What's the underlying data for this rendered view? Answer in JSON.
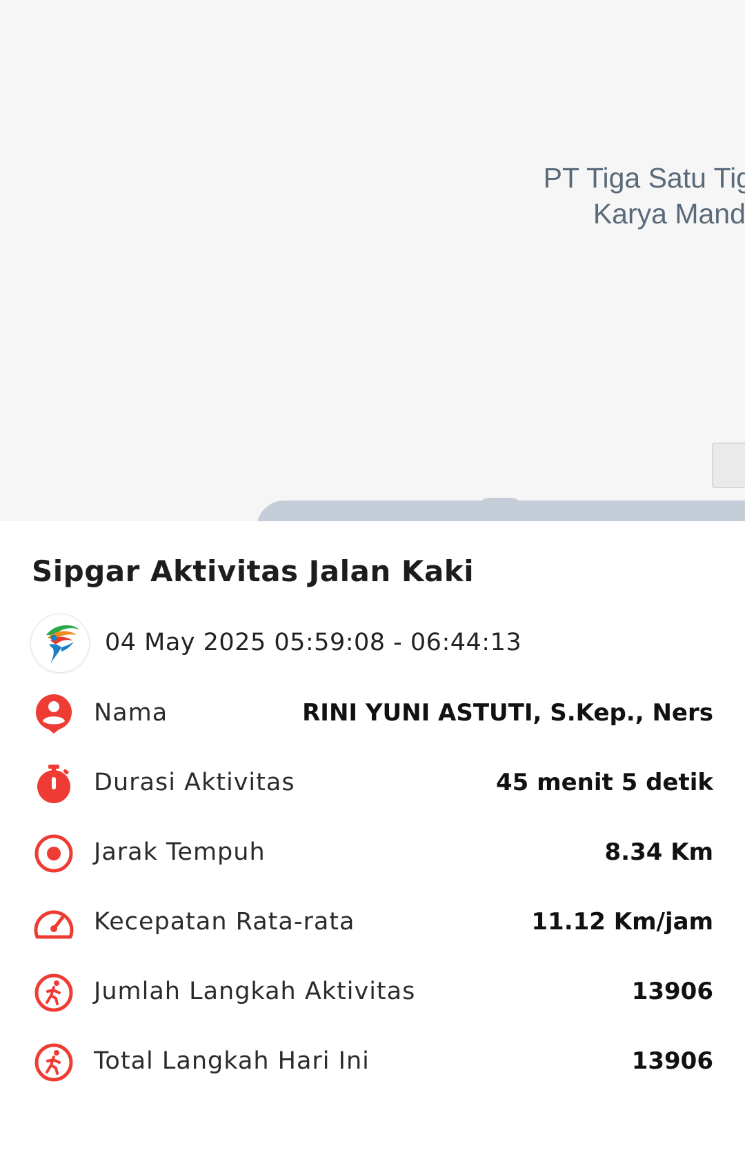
{
  "map": {
    "place_line1": "PT Tiga Satu Tig",
    "place_line2": "Karya Mandi"
  },
  "activity": {
    "title": "Sipgar Aktivitas Jalan Kaki",
    "datetime": "04 May 2025 05:59:08 - 06:44:13"
  },
  "stats": [
    {
      "icon": "person-pin-icon",
      "label": "Nama",
      "value": "RINI YUNI ASTUTI, S.Kep., Ners"
    },
    {
      "icon": "stopwatch-icon",
      "label": "Durasi Aktivitas",
      "value": "45 menit 5 detik"
    },
    {
      "icon": "target-icon",
      "label": "Jarak Tempuh",
      "value": "8.34 Km"
    },
    {
      "icon": "speedometer-icon",
      "label": "Kecepatan Rata-rata",
      "value": "11.12 Km/jam"
    },
    {
      "icon": "walking-icon",
      "label": "Jumlah Langkah Aktivitas",
      "value": "13906"
    },
    {
      "icon": "walking-icon",
      "label": "Total Langkah Hari Ini",
      "value": "13906"
    }
  ],
  "colors": {
    "accent_red": "#ee3b33",
    "map_background": "#f6f6f6"
  }
}
